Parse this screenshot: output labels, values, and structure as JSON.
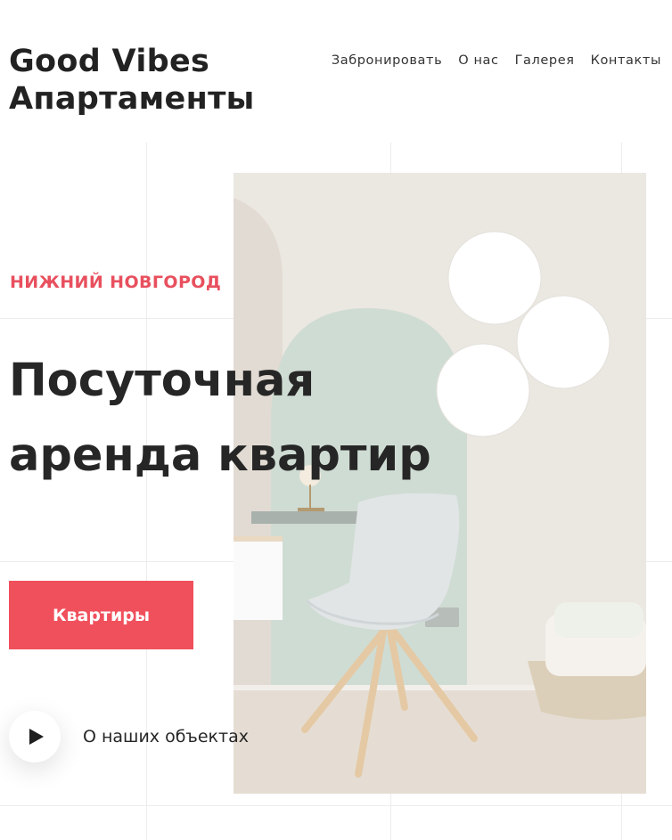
{
  "header": {
    "logo_line1": "Good Vibes",
    "logo_line2": "Апартаменты",
    "nav": [
      {
        "label": "Забронировать"
      },
      {
        "label": "О нас"
      },
      {
        "label": "Галерея"
      },
      {
        "label": "Контакты"
      }
    ]
  },
  "hero": {
    "city": "НИЖНИЙ НОВГОРОД",
    "headline_line1": "Посуточная",
    "headline_line2": "аренда квартир",
    "cta_label": "Квартиры",
    "video_label": "О наших объектах",
    "photo_alt": "Интерьер квартиры со стулом и круглыми светильниками"
  },
  "colors": {
    "accent": "#f0505c",
    "city_text": "#e8505e",
    "text": "#222222"
  },
  "icons": {
    "play": "play-icon"
  }
}
